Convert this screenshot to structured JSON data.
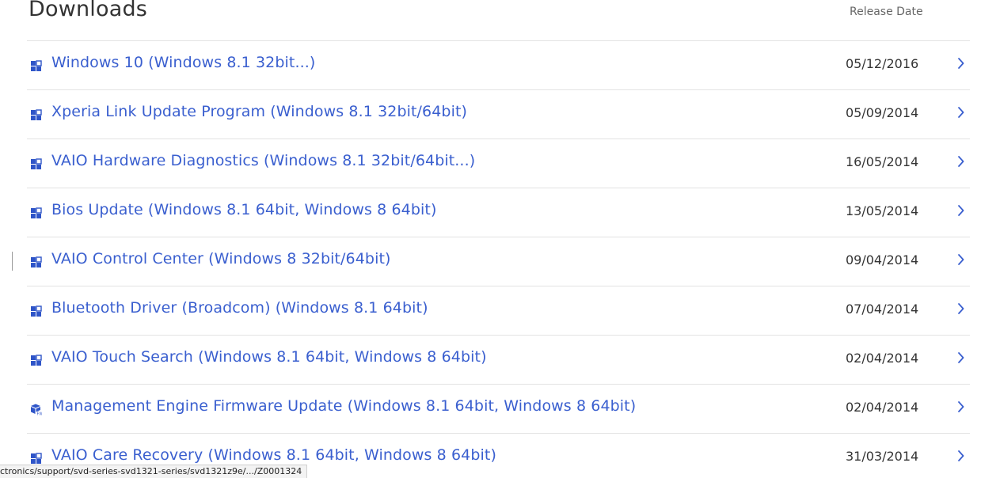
{
  "header": {
    "title": "Downloads",
    "release_date_label": "Release Date"
  },
  "downloads": [
    {
      "name": "Windows 10 (Windows 8.1 32bit...)",
      "date": "05/12/2016",
      "icon": "software-package-icon"
    },
    {
      "name": "Xperia Link Update Program (Windows 8.1 32bit/64bit)",
      "date": "05/09/2014",
      "icon": "software-package-icon"
    },
    {
      "name": "VAIO Hardware Diagnostics (Windows 8.1 32bit/64bit...)",
      "date": "16/05/2014",
      "icon": "software-package-icon"
    },
    {
      "name": "Bios Update (Windows 8.1 64bit, Windows 8 64bit)",
      "date": "13/05/2014",
      "icon": "software-package-icon"
    },
    {
      "name": "VAIO Control Center (Windows 8 32bit/64bit)",
      "date": "09/04/2014",
      "icon": "software-package-icon"
    },
    {
      "name": "Bluetooth Driver (Broadcom) (Windows 8.1 64bit)",
      "date": "07/04/2014",
      "icon": "software-package-icon"
    },
    {
      "name": "VAIO Touch Search (Windows 8.1 64bit, Windows 8 64bit)",
      "date": "02/04/2014",
      "icon": "software-package-icon"
    },
    {
      "name": "Management Engine Firmware Update (Windows 8.1 64bit, Windows 8 64bit)",
      "date": "02/04/2014",
      "icon": "firmware-package-icon"
    },
    {
      "name": "VAIO Care Recovery (Windows 8.1 64bit, Windows 8 64bit)",
      "date": "31/03/2014",
      "icon": "software-package-icon"
    }
  ],
  "status_bar": {
    "url": "ctronics/support/svd-series-svd1321-series/svd1321z9e/.../Z0001324"
  },
  "colors": {
    "link": "#3a5fcf",
    "icon": "#2f55c8",
    "chevron": "#3a5fcf",
    "divider": "#e3e3e3"
  }
}
